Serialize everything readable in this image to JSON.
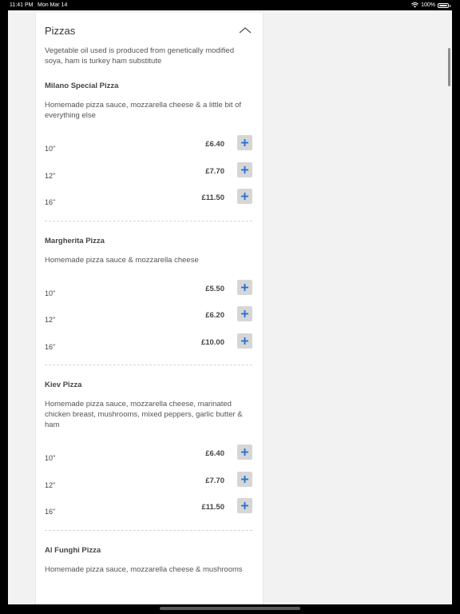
{
  "status_bar": {
    "time": "11:41 PM",
    "date": "Mon Mar 14",
    "battery_percent": "100%",
    "battery_level": 1.0,
    "icons": [
      "wifi-icon",
      "battery-icon"
    ]
  },
  "section": {
    "title": "Pizzas",
    "note": "Vegetable oil used is produced from genetically modified soya, ham is turkey ham substitute",
    "expanded": true
  },
  "products": [
    {
      "name": "Milano Special Pizza",
      "description": "Homemade pizza sauce, mozzarella cheese & a little bit of everything else",
      "sizes": [
        {
          "label": "10\"",
          "price": "£6.40"
        },
        {
          "label": "12\"",
          "price": "£7.70"
        },
        {
          "label": "16\"",
          "price": "£11.50"
        }
      ]
    },
    {
      "name": "Margherita Pizza",
      "description": "Homemade pizza sauce & mozzarella cheese",
      "sizes": [
        {
          "label": "10\"",
          "price": "£5.50"
        },
        {
          "label": "12\"",
          "price": "£6.20"
        },
        {
          "label": "16\"",
          "price": "£10.00"
        }
      ]
    },
    {
      "name": "Kiev Pizza",
      "description": "Homemade pizza sauce, mozzarella cheese, marinated chicken breast, mushrooms, mixed peppers, garlic butter & ham",
      "sizes": [
        {
          "label": "10\"",
          "price": "£6.40"
        },
        {
          "label": "12\"",
          "price": "£7.70"
        },
        {
          "label": "16\"",
          "price": "£11.50"
        }
      ]
    },
    {
      "name": "Al Funghi Pizza",
      "description": "Homemade pizza sauce, mozzarella cheese & mushrooms",
      "sizes": []
    }
  ],
  "colors": {
    "accent_plus": "#1f6fd1",
    "add_button_bg": "#d6d6d6",
    "page_bg": "#f2f2f2"
  }
}
